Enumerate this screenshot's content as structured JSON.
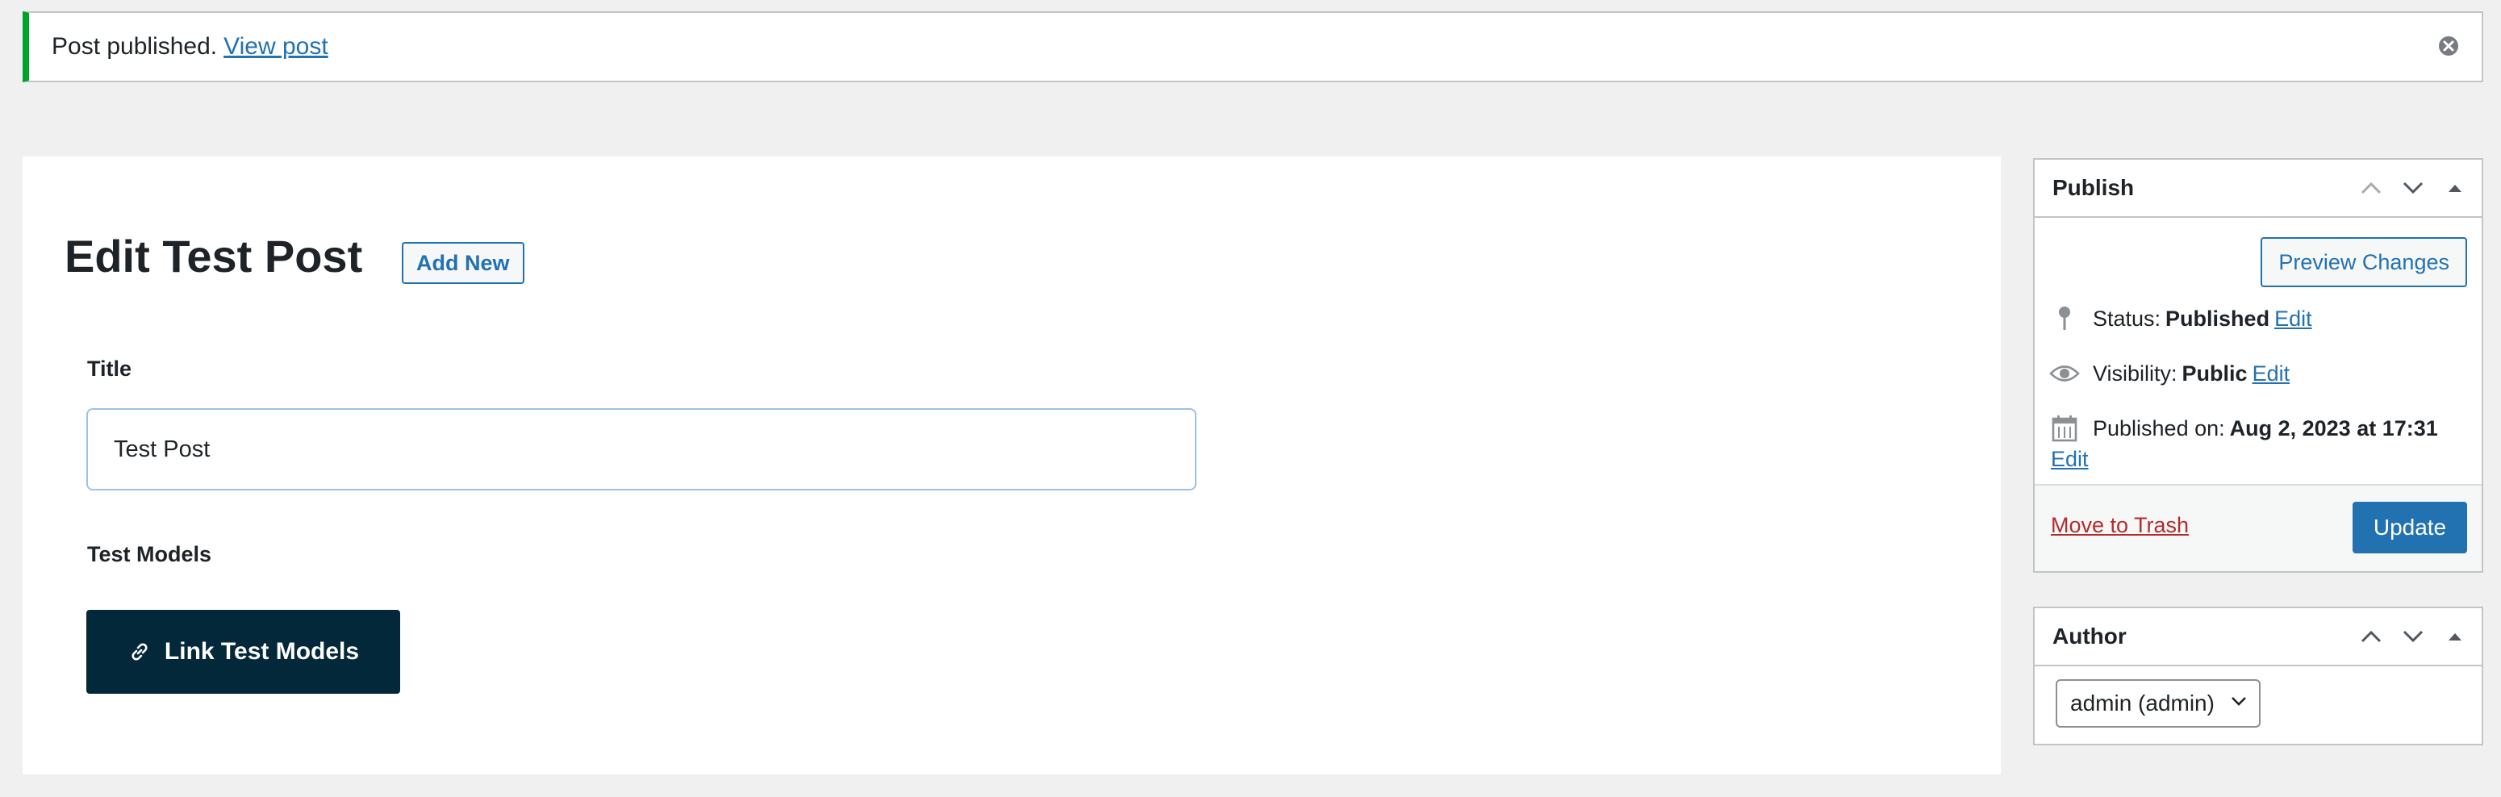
{
  "notice": {
    "message": "Post published.",
    "link": "View post"
  },
  "page": {
    "title": "Edit Test Post",
    "add_new": "Add New"
  },
  "fields": {
    "title_label": "Title",
    "title_value": "Test Post",
    "models_label": "Test Models",
    "link_button": "Link Test Models"
  },
  "publish": {
    "heading": "Publish",
    "preview": "Preview Changes",
    "status_label": "Status:",
    "status_value": "Published",
    "visibility_label": "Visibility:",
    "visibility_value": "Public",
    "published_label": "Published on:",
    "published_value": "Aug 2, 2023 at 17:31",
    "edit": "Edit",
    "trash": "Move to Trash",
    "update": "Update"
  },
  "author": {
    "heading": "Author",
    "selected": "admin (admin)"
  },
  "colors": {
    "accent": "#2271b1",
    "success": "#00a32a",
    "dark_button": "#02283a",
    "danger": "#b32d2e"
  }
}
